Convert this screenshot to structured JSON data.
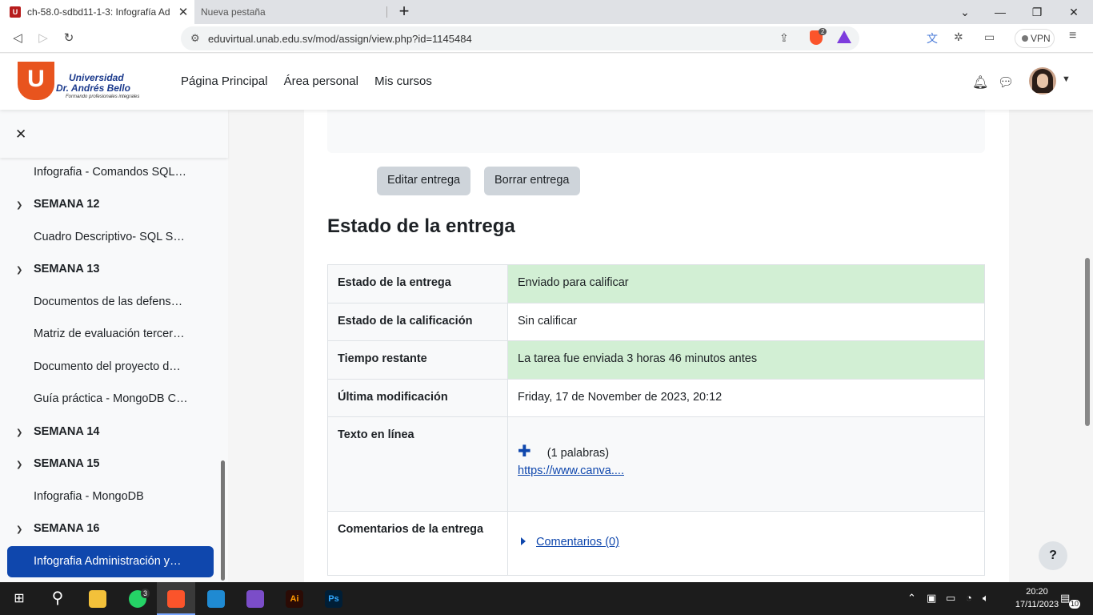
{
  "browser": {
    "tabs": [
      {
        "title": "ch-58.0-sdbd11-1-3: Infografía Ad",
        "close": "✕"
      },
      {
        "title": "Nueva pestaña"
      }
    ],
    "url": "eduvirtual.unab.edu.sv/mod/assign/view.php?id=1145484",
    "shield_count": "2",
    "vpn_label": "VPN"
  },
  "logo": {
    "line1": "Universidad",
    "line2": "Dr. Andrés Bello",
    "line3": "Formando profesionales integrales"
  },
  "nav": {
    "items": [
      "Página Principal",
      "Área personal",
      "Mis cursos"
    ]
  },
  "drawer": {
    "items": [
      {
        "text": "Infografia - Comandos SQL…"
      },
      {
        "section": "SEMANA 12"
      },
      {
        "text": "Cuadro Descriptivo- SQL S…"
      },
      {
        "section": "SEMANA 13"
      },
      {
        "text": "Documentos de las defens…"
      },
      {
        "text": "Matriz de evaluación tercer…"
      },
      {
        "text": "Documento del proyecto d…"
      },
      {
        "text": "Guía práctica - MongoDB C…"
      },
      {
        "section": "SEMANA 14"
      },
      {
        "section": "SEMANA 15"
      },
      {
        "text": "Infografia - MongoDB"
      },
      {
        "section": "SEMANA 16"
      }
    ],
    "active": "Infografia Administración y…"
  },
  "buttons": {
    "edit": "Editar entrega",
    "delete": "Borrar entrega"
  },
  "status": {
    "heading": "Estado de la entrega",
    "rows": [
      {
        "label": "Estado de la entrega",
        "value": "Enviado para calificar"
      },
      {
        "label": "Estado de la calificación",
        "value": "Sin calificar"
      },
      {
        "label": "Tiempo restante",
        "value": "La tarea fue enviada 3 horas 46 minutos antes"
      },
      {
        "label": "Última modificación",
        "value": "Friday, 17 de November de 2023, 20:12"
      },
      {
        "label": "Texto en línea",
        "words": "(1 palabras)",
        "link": "https://www.canva...."
      },
      {
        "label": "Comentarios de la entrega",
        "comments": "Comentarios (0)"
      }
    ]
  },
  "help": "?",
  "taskbar": {
    "whatsapp_badge": "3",
    "ai_label": "Ai",
    "ps_label": "Ps",
    "time": "20:20",
    "date": "17/11/2023",
    "notif_count": "10"
  }
}
